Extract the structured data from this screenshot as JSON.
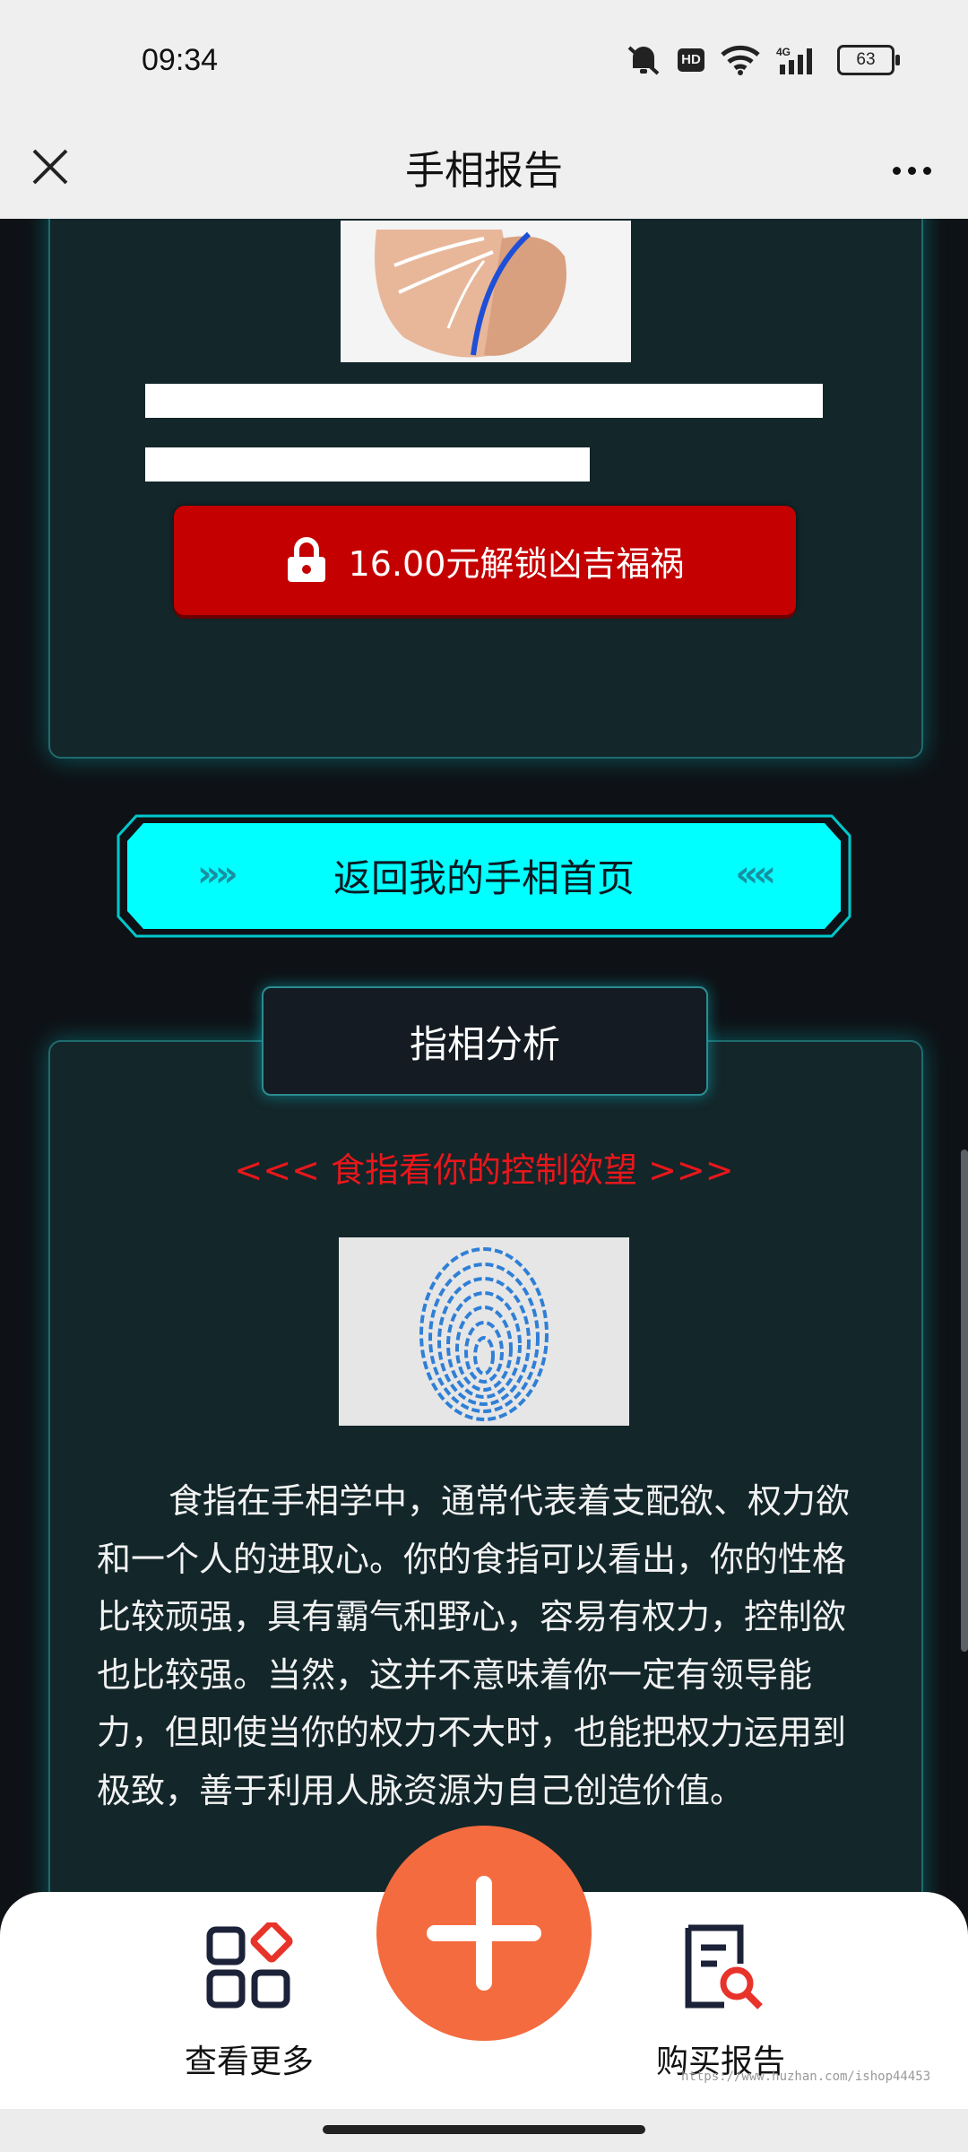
{
  "status_bar": {
    "time": "09:34",
    "hd": "HD",
    "network": "4G",
    "battery": "63"
  },
  "nav": {
    "title": "手相报告",
    "close_icon": "close-icon",
    "more_icon": "more-dots-icon"
  },
  "card1": {
    "image": "palm-life-line-image",
    "unlock_button": "16.00元解锁凶吉福祸",
    "lock_icon": "lock-icon"
  },
  "home_button": {
    "label": "返回我的手相首页",
    "left_chevrons": "»»",
    "right_chevrons": "««"
  },
  "section": {
    "tab_title": "指相分析",
    "heading": "<<< 食指看你的控制欲望 >>>",
    "heading_color": "#e8171b",
    "image": "fingerprint-image",
    "paragraph": "食指在手相学中，通常代表着支配欲、权力欲和一个人的进取心。你的食指可以看出，你的性格比较顽强，具有霸气和野心，容易有权力，控制欲也比较强。当然，这并不意味着你一定有领导能力，但即使当你的权力不大时，也能把权力运用到极致，善于利用人脉资源为自己创造价值。"
  },
  "tab_bar": {
    "left_label": "查看更多",
    "right_label": "购买报告",
    "fab_icon": "plus-icon",
    "accent": "#f46b3f"
  },
  "watermark": "https://www.huzhan.com/ishop44453",
  "colors": {
    "cyan": "#00ffff",
    "red_button": "#c40000",
    "card_bg": "#13262a"
  }
}
